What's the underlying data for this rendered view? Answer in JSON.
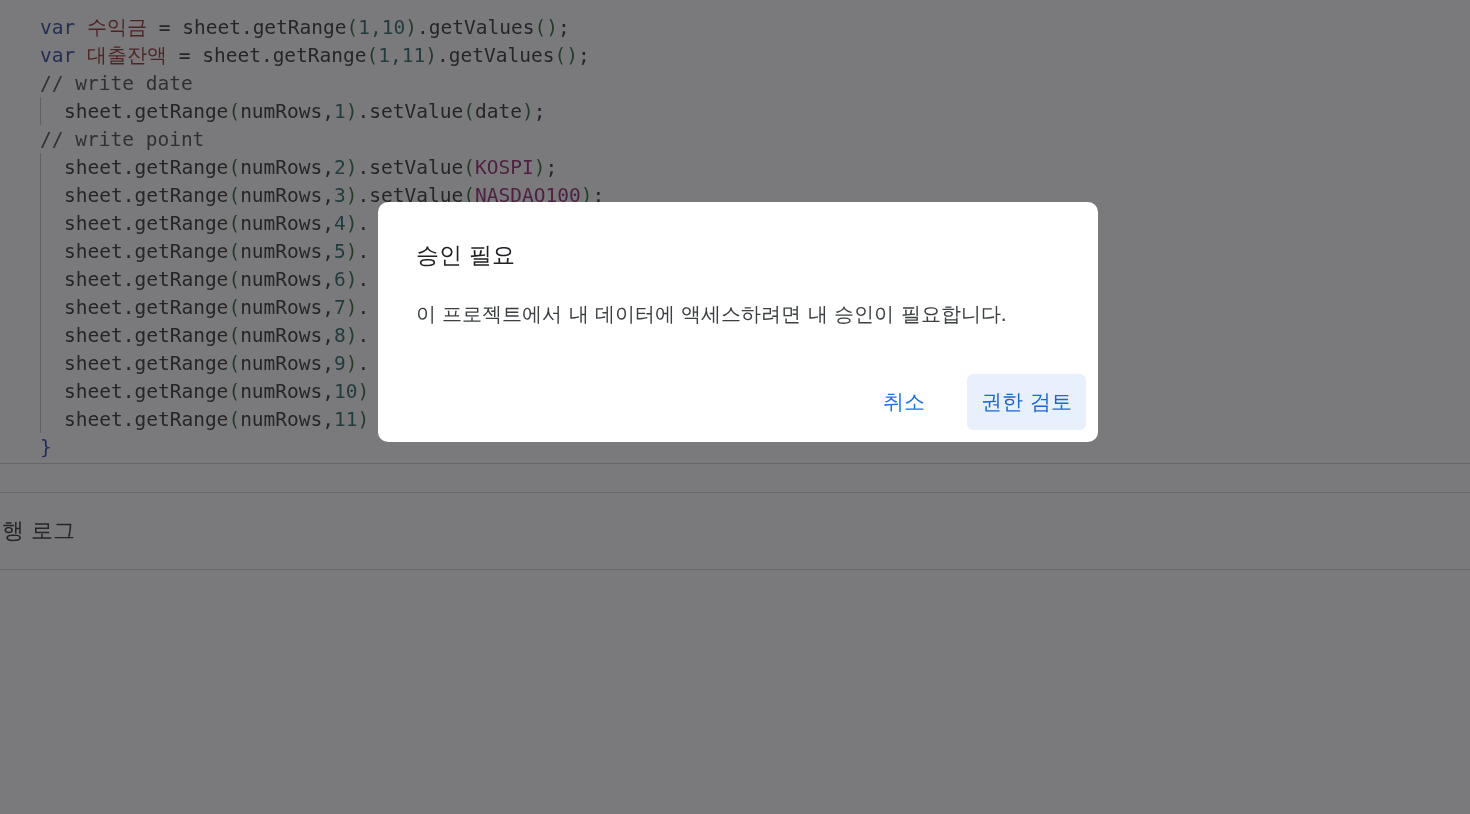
{
  "code_lines": [
    {
      "tokens": [
        {
          "kind": "keyword",
          "text": "var "
        },
        {
          "kind": "variable",
          "text": "수익금"
        },
        {
          "kind": "plain",
          "text": " = sheet.getRange"
        },
        {
          "kind": "paren",
          "text": "("
        },
        {
          "kind": "number",
          "text": "1,10"
        },
        {
          "kind": "paren",
          "text": ")"
        },
        {
          "kind": "plain",
          "text": ".getValues"
        },
        {
          "kind": "paren",
          "text": "()"
        },
        {
          "kind": "plain",
          "text": ";"
        }
      ]
    },
    {
      "tokens": [
        {
          "kind": "keyword",
          "text": "var "
        },
        {
          "kind": "variable",
          "text": "대출잔액"
        },
        {
          "kind": "plain",
          "text": " = sheet.getRange"
        },
        {
          "kind": "paren",
          "text": "("
        },
        {
          "kind": "number",
          "text": "1,11"
        },
        {
          "kind": "paren",
          "text": ")"
        },
        {
          "kind": "plain",
          "text": ".getValues"
        },
        {
          "kind": "paren",
          "text": "()"
        },
        {
          "kind": "plain",
          "text": ";"
        }
      ]
    },
    {
      "tokens": [
        {
          "kind": "comment",
          "text": "// write date"
        }
      ],
      "children": [
        {
          "tokens": [
            {
              "kind": "plain",
              "text": "sheet.getRange"
            },
            {
              "kind": "paren",
              "text": "("
            },
            {
              "kind": "plain",
              "text": "numRows,"
            },
            {
              "kind": "number",
              "text": "1"
            },
            {
              "kind": "paren",
              "text": ")"
            },
            {
              "kind": "plain",
              "text": ".setValue"
            },
            {
              "kind": "paren",
              "text": "("
            },
            {
              "kind": "plain",
              "text": "date"
            },
            {
              "kind": "paren",
              "text": ")"
            },
            {
              "kind": "plain",
              "text": ";"
            }
          ]
        }
      ]
    },
    {
      "tokens": [
        {
          "kind": "comment",
          "text": "// write point"
        }
      ],
      "children": [
        {
          "tokens": [
            {
              "kind": "plain",
              "text": "sheet.getRange"
            },
            {
              "kind": "paren",
              "text": "("
            },
            {
              "kind": "plain",
              "text": "numRows,"
            },
            {
              "kind": "number",
              "text": "2"
            },
            {
              "kind": "paren",
              "text": ")"
            },
            {
              "kind": "plain",
              "text": ".setValue"
            },
            {
              "kind": "paren",
              "text": "("
            },
            {
              "kind": "ident",
              "text": "KOSPI"
            },
            {
              "kind": "paren",
              "text": ")"
            },
            {
              "kind": "plain",
              "text": ";"
            }
          ]
        },
        {
          "tokens": [
            {
              "kind": "plain",
              "text": "sheet.getRange"
            },
            {
              "kind": "paren",
              "text": "("
            },
            {
              "kind": "plain",
              "text": "numRows,"
            },
            {
              "kind": "number",
              "text": "3"
            },
            {
              "kind": "paren",
              "text": ")"
            },
            {
              "kind": "plain",
              "text": ".setValue"
            },
            {
              "kind": "paren",
              "text": "("
            },
            {
              "kind": "ident",
              "text": "NASDAQ100"
            },
            {
              "kind": "paren",
              "text": ")"
            },
            {
              "kind": "plain",
              "text": ";"
            }
          ]
        },
        {
          "tokens": [
            {
              "kind": "plain",
              "text": "sheet.getRange"
            },
            {
              "kind": "paren",
              "text": "("
            },
            {
              "kind": "plain",
              "text": "numRows,"
            },
            {
              "kind": "number",
              "text": "4"
            },
            {
              "kind": "paren",
              "text": ")"
            },
            {
              "kind": "plain",
              "text": "."
            }
          ]
        },
        {
          "tokens": [
            {
              "kind": "plain",
              "text": "sheet.getRange"
            },
            {
              "kind": "paren",
              "text": "("
            },
            {
              "kind": "plain",
              "text": "numRows,"
            },
            {
              "kind": "number",
              "text": "5"
            },
            {
              "kind": "paren",
              "text": ")"
            },
            {
              "kind": "plain",
              "text": "."
            }
          ]
        },
        {
          "tokens": [
            {
              "kind": "plain",
              "text": "sheet.getRange"
            },
            {
              "kind": "paren",
              "text": "("
            },
            {
              "kind": "plain",
              "text": "numRows,"
            },
            {
              "kind": "number",
              "text": "6"
            },
            {
              "kind": "paren",
              "text": ")"
            },
            {
              "kind": "plain",
              "text": "."
            }
          ]
        },
        {
          "tokens": [
            {
              "kind": "plain",
              "text": "sheet.getRange"
            },
            {
              "kind": "paren",
              "text": "("
            },
            {
              "kind": "plain",
              "text": "numRows,"
            },
            {
              "kind": "number",
              "text": "7"
            },
            {
              "kind": "paren",
              "text": ")"
            },
            {
              "kind": "plain",
              "text": "."
            }
          ]
        },
        {
          "tokens": [
            {
              "kind": "plain",
              "text": "sheet.getRange"
            },
            {
              "kind": "paren",
              "text": "("
            },
            {
              "kind": "plain",
              "text": "numRows,"
            },
            {
              "kind": "number",
              "text": "8"
            },
            {
              "kind": "paren",
              "text": ")"
            },
            {
              "kind": "plain",
              "text": "."
            }
          ]
        },
        {
          "tokens": [
            {
              "kind": "plain",
              "text": "sheet.getRange"
            },
            {
              "kind": "paren",
              "text": "("
            },
            {
              "kind": "plain",
              "text": "numRows,"
            },
            {
              "kind": "number",
              "text": "9"
            },
            {
              "kind": "paren",
              "text": ")"
            },
            {
              "kind": "plain",
              "text": "."
            }
          ]
        },
        {
          "tokens": [
            {
              "kind": "plain",
              "text": "sheet.getRange"
            },
            {
              "kind": "paren",
              "text": "("
            },
            {
              "kind": "plain",
              "text": "numRows,"
            },
            {
              "kind": "number",
              "text": "10"
            },
            {
              "kind": "paren",
              "text": ")"
            }
          ]
        },
        {
          "tokens": [
            {
              "kind": "plain",
              "text": "sheet.getRange"
            },
            {
              "kind": "paren",
              "text": "("
            },
            {
              "kind": "plain",
              "text": "numRows,"
            },
            {
              "kind": "number",
              "text": "11"
            },
            {
              "kind": "paren",
              "text": ")"
            }
          ]
        }
      ]
    },
    {
      "tokens": [
        {
          "kind": "brace",
          "text": "}"
        }
      ]
    }
  ],
  "log_panel": {
    "title": "행 로그"
  },
  "dialog": {
    "title": "승인 필요",
    "message": "이 프로젝트에서 내 데이터에 액세스하려면 내 승인이 필요합니다.",
    "buttons": [
      {
        "label": "취소",
        "kind": "text"
      },
      {
        "label": "권한 검토",
        "kind": "tonal"
      }
    ]
  }
}
